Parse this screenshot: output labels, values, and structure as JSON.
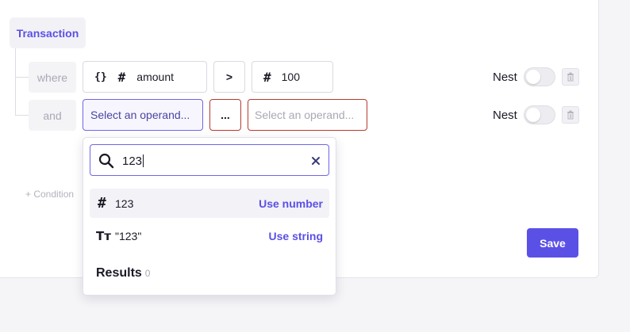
{
  "entity": {
    "label": "Transaction"
  },
  "rows": [
    {
      "conjunction": "where",
      "left_operand": {
        "glyph": "{}",
        "type_glyph": "#",
        "label": "amount"
      },
      "operator": ">",
      "right_operand": {
        "type_glyph": "#",
        "value": "100"
      },
      "nest_label": "Nest",
      "nest_enabled": false
    },
    {
      "conjunction": "and",
      "left_operand": {
        "placeholder": "Select an operand..."
      },
      "operator": "...",
      "right_operand": {
        "placeholder": "Select an operand..."
      },
      "nest_label": "Nest",
      "nest_enabled": false
    }
  ],
  "add_condition": {
    "label": "+ Condition"
  },
  "save_button": {
    "label": "Save"
  },
  "dropdown": {
    "search_value": "123",
    "options": [
      {
        "icon": "number-icon",
        "icon_glyph": "#",
        "text": "123",
        "action": "Use number",
        "highlighted": true
      },
      {
        "icon": "text-type-icon",
        "icon_glyph": "Tт",
        "text": "\"123\"",
        "action": "Use string",
        "highlighted": false
      }
    ],
    "results": {
      "label": "Results",
      "count": "0"
    }
  },
  "colors": {
    "accent": "#5b50e6",
    "error_border": "#b83a30",
    "selected_border": "#6e66e8"
  }
}
